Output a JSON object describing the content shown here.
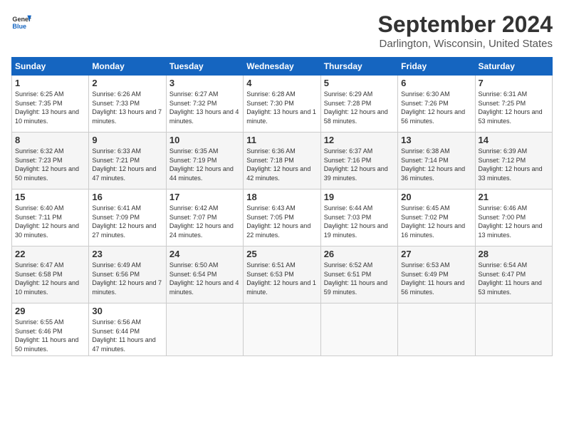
{
  "header": {
    "logo_line1": "General",
    "logo_line2": "Blue",
    "month": "September 2024",
    "location": "Darlington, Wisconsin, United States"
  },
  "days_of_week": [
    "Sunday",
    "Monday",
    "Tuesday",
    "Wednesday",
    "Thursday",
    "Friday",
    "Saturday"
  ],
  "weeks": [
    [
      {
        "day": "1",
        "sunrise": "6:25 AM",
        "sunset": "7:35 PM",
        "daylight": "13 hours and 10 minutes."
      },
      {
        "day": "2",
        "sunrise": "6:26 AM",
        "sunset": "7:33 PM",
        "daylight": "13 hours and 7 minutes."
      },
      {
        "day": "3",
        "sunrise": "6:27 AM",
        "sunset": "7:32 PM",
        "daylight": "13 hours and 4 minutes."
      },
      {
        "day": "4",
        "sunrise": "6:28 AM",
        "sunset": "7:30 PM",
        "daylight": "13 hours and 1 minute."
      },
      {
        "day": "5",
        "sunrise": "6:29 AM",
        "sunset": "7:28 PM",
        "daylight": "12 hours and 58 minutes."
      },
      {
        "day": "6",
        "sunrise": "6:30 AM",
        "sunset": "7:26 PM",
        "daylight": "12 hours and 56 minutes."
      },
      {
        "day": "7",
        "sunrise": "6:31 AM",
        "sunset": "7:25 PM",
        "daylight": "12 hours and 53 minutes."
      }
    ],
    [
      {
        "day": "8",
        "sunrise": "6:32 AM",
        "sunset": "7:23 PM",
        "daylight": "12 hours and 50 minutes."
      },
      {
        "day": "9",
        "sunrise": "6:33 AM",
        "sunset": "7:21 PM",
        "daylight": "12 hours and 47 minutes."
      },
      {
        "day": "10",
        "sunrise": "6:35 AM",
        "sunset": "7:19 PM",
        "daylight": "12 hours and 44 minutes."
      },
      {
        "day": "11",
        "sunrise": "6:36 AM",
        "sunset": "7:18 PM",
        "daylight": "12 hours and 42 minutes."
      },
      {
        "day": "12",
        "sunrise": "6:37 AM",
        "sunset": "7:16 PM",
        "daylight": "12 hours and 39 minutes."
      },
      {
        "day": "13",
        "sunrise": "6:38 AM",
        "sunset": "7:14 PM",
        "daylight": "12 hours and 36 minutes."
      },
      {
        "day": "14",
        "sunrise": "6:39 AM",
        "sunset": "7:12 PM",
        "daylight": "12 hours and 33 minutes."
      }
    ],
    [
      {
        "day": "15",
        "sunrise": "6:40 AM",
        "sunset": "7:11 PM",
        "daylight": "12 hours and 30 minutes."
      },
      {
        "day": "16",
        "sunrise": "6:41 AM",
        "sunset": "7:09 PM",
        "daylight": "12 hours and 27 minutes."
      },
      {
        "day": "17",
        "sunrise": "6:42 AM",
        "sunset": "7:07 PM",
        "daylight": "12 hours and 24 minutes."
      },
      {
        "day": "18",
        "sunrise": "6:43 AM",
        "sunset": "7:05 PM",
        "daylight": "12 hours and 22 minutes."
      },
      {
        "day": "19",
        "sunrise": "6:44 AM",
        "sunset": "7:03 PM",
        "daylight": "12 hours and 19 minutes."
      },
      {
        "day": "20",
        "sunrise": "6:45 AM",
        "sunset": "7:02 PM",
        "daylight": "12 hours and 16 minutes."
      },
      {
        "day": "21",
        "sunrise": "6:46 AM",
        "sunset": "7:00 PM",
        "daylight": "12 hours and 13 minutes."
      }
    ],
    [
      {
        "day": "22",
        "sunrise": "6:47 AM",
        "sunset": "6:58 PM",
        "daylight": "12 hours and 10 minutes."
      },
      {
        "day": "23",
        "sunrise": "6:49 AM",
        "sunset": "6:56 PM",
        "daylight": "12 hours and 7 minutes."
      },
      {
        "day": "24",
        "sunrise": "6:50 AM",
        "sunset": "6:54 PM",
        "daylight": "12 hours and 4 minutes."
      },
      {
        "day": "25",
        "sunrise": "6:51 AM",
        "sunset": "6:53 PM",
        "daylight": "12 hours and 1 minute."
      },
      {
        "day": "26",
        "sunrise": "6:52 AM",
        "sunset": "6:51 PM",
        "daylight": "11 hours and 59 minutes."
      },
      {
        "day": "27",
        "sunrise": "6:53 AM",
        "sunset": "6:49 PM",
        "daylight": "11 hours and 56 minutes."
      },
      {
        "day": "28",
        "sunrise": "6:54 AM",
        "sunset": "6:47 PM",
        "daylight": "11 hours and 53 minutes."
      }
    ],
    [
      {
        "day": "29",
        "sunrise": "6:55 AM",
        "sunset": "6:46 PM",
        "daylight": "11 hours and 50 minutes."
      },
      {
        "day": "30",
        "sunrise": "6:56 AM",
        "sunset": "6:44 PM",
        "daylight": "11 hours and 47 minutes."
      },
      null,
      null,
      null,
      null,
      null
    ]
  ]
}
